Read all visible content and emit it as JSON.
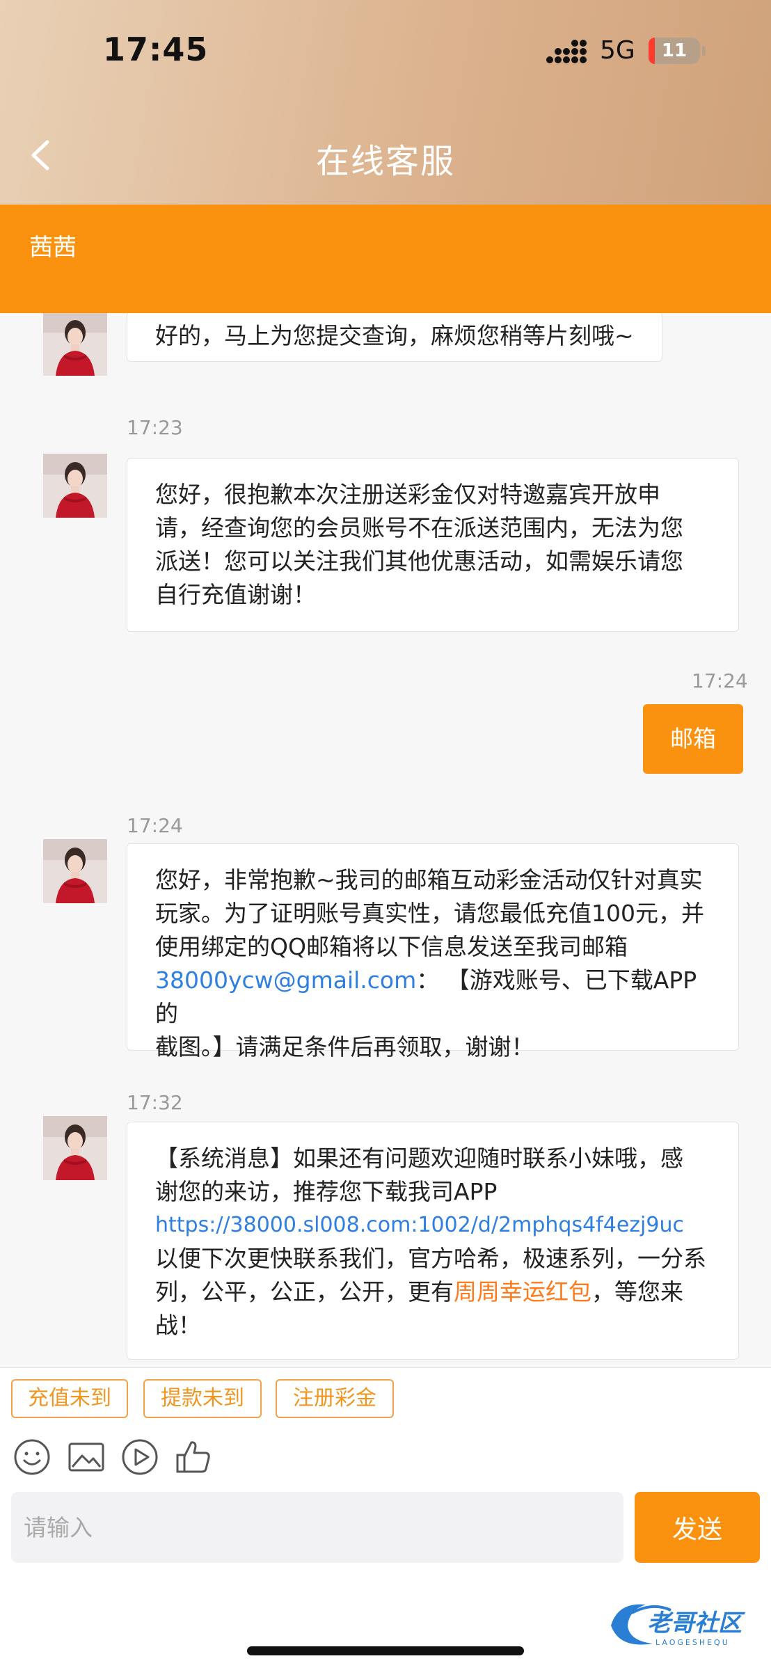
{
  "status_bar": {
    "time": "17:45",
    "network": "5G",
    "battery": "11"
  },
  "header": {
    "title": "在线客服",
    "agent_name": "茜茜"
  },
  "messages": [
    {
      "from": "agent",
      "time": "",
      "text": "好的，马上为您提交查询，麻烦您稍等片刻哦~"
    },
    {
      "from": "agent",
      "time": "17:23",
      "lines": [
        "您好，很抱歉本次注册送彩金仅对特邀嘉宾开放申",
        "请，经查询您的会员账号不在派送范围内，无法为您",
        "派送！您可以关注我们其他优惠活动，如需娱乐请您",
        "自行充值谢谢！"
      ]
    },
    {
      "from": "user",
      "time": "17:24",
      "text": "邮箱"
    },
    {
      "from": "agent",
      "time": "17:24",
      "lines": [
        "您好，非常抱歉~我司的邮箱互动彩金活动仅针对真实",
        "玩家。为了证明账号真实性，请您最低充值100元，并",
        "使用绑定的QQ邮箱将以下信息发送至我司邮箱"
      ],
      "email": "38000ycw@gmail.com",
      "after_email": "： 【游戏账号、已下载APP的",
      "last_line": "截图。】请满足条件后再领取，谢谢！"
    },
    {
      "from": "agent",
      "time": "17:32",
      "lines": [
        "【系统消息】如果还有问题欢迎随时联系小妹哦，感",
        "谢您的来访，推荐您下载我司APP"
      ],
      "url": "https://38000.sl008.com:1002/d/2mphqs4f4ezj9uc",
      "line_after_url": "以便下次更快联系我们，官方哈希，极速系列，一分系",
      "line_pre": "列，公平，公正，公开，更有",
      "highlight": "周周幸运红包",
      "line_post": "，等您来",
      "last_line": "战！"
    }
  ],
  "quick_replies": [
    "充值未到",
    "提款未到",
    "注册彩金"
  ],
  "toolbar_icons": [
    "emoji-icon",
    "image-icon",
    "video-icon",
    "thumbs-up-icon"
  ],
  "composer": {
    "placeholder": "请输入",
    "send_label": "发送"
  },
  "watermark": {
    "title": "老哥社区",
    "subtitle": "LAOGESHEQU"
  },
  "colors": {
    "accent": "#fb920f",
    "link": "#2f7fe0",
    "highlight": "#ff7a1a",
    "header_gradient_start": "#e9d1b6",
    "header_gradient_end": "#cfa27a"
  }
}
